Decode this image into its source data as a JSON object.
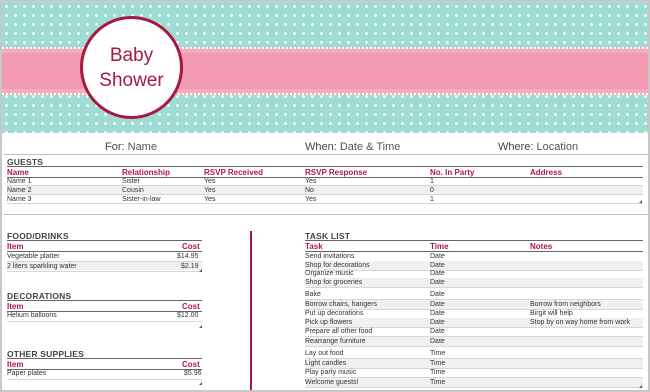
{
  "banner": {
    "title_line1": "Baby",
    "title_line2": "Shower"
  },
  "info": {
    "for_label": "For:",
    "for_value": "Name",
    "when_label": "When:",
    "when_value": "Date & Time",
    "where_label": "Where:",
    "where_value": "Location"
  },
  "guests": {
    "title": "GUESTS",
    "headers": [
      "Name",
      "Relationship",
      "RSVP Received",
      "RSVP Response",
      "No. In Party",
      "Address"
    ],
    "rows": [
      [
        "Name 1",
        "Sister",
        "Yes",
        "Yes",
        "1",
        ""
      ],
      [
        "Name 2",
        "Cousin",
        "Yes",
        "No",
        "0",
        ""
      ],
      [
        "Name 3",
        "Sister-in-law",
        "Yes",
        "Yes",
        "1",
        ""
      ]
    ]
  },
  "food": {
    "title": "FOOD/DRINKS",
    "headers": [
      "Item",
      "Cost"
    ],
    "rows": [
      [
        "Vegetable platter",
        "$14.95"
      ],
      [
        "2 liters sparkling water",
        "$2.19"
      ]
    ]
  },
  "decorations": {
    "title": "DECORATIONS",
    "headers": [
      "Item",
      "Cost"
    ],
    "rows": [
      [
        "Helium balloons",
        "$12.00"
      ]
    ]
  },
  "supplies": {
    "title": "OTHER SUPPLIES",
    "headers": [
      "Item",
      "Cost"
    ],
    "rows": [
      [
        "Paper plates",
        "$5.96"
      ]
    ]
  },
  "tasks": {
    "title": "TASK LIST",
    "headers": [
      "Task",
      "Time",
      "Notes"
    ],
    "rows": [
      [
        "Send invitations",
        "Date",
        ""
      ],
      [
        "Shop for decorations",
        "Date",
        ""
      ],
      [
        "Organize music",
        "Date",
        ""
      ],
      [
        "Shop for groceries",
        "Date",
        ""
      ],
      [
        "Bake",
        "Date",
        ""
      ],
      [
        "Borrow chairs, hangers",
        "Date",
        "Borrow from neighbors"
      ],
      [
        "Put up decorations",
        "Date",
        "Birgit will help"
      ],
      [
        "Pick up flowers",
        "Date",
        "Stop by on way home from work"
      ],
      [
        "Prepare all other food",
        "Date",
        ""
      ],
      [
        "Rearrange furniture",
        "Date",
        ""
      ],
      [
        "Lay out food",
        "Time",
        ""
      ],
      [
        "Light candles",
        "Time",
        ""
      ],
      [
        "Play party music",
        "Time",
        ""
      ],
      [
        "Welcome guests!",
        "Time",
        ""
      ]
    ]
  }
}
